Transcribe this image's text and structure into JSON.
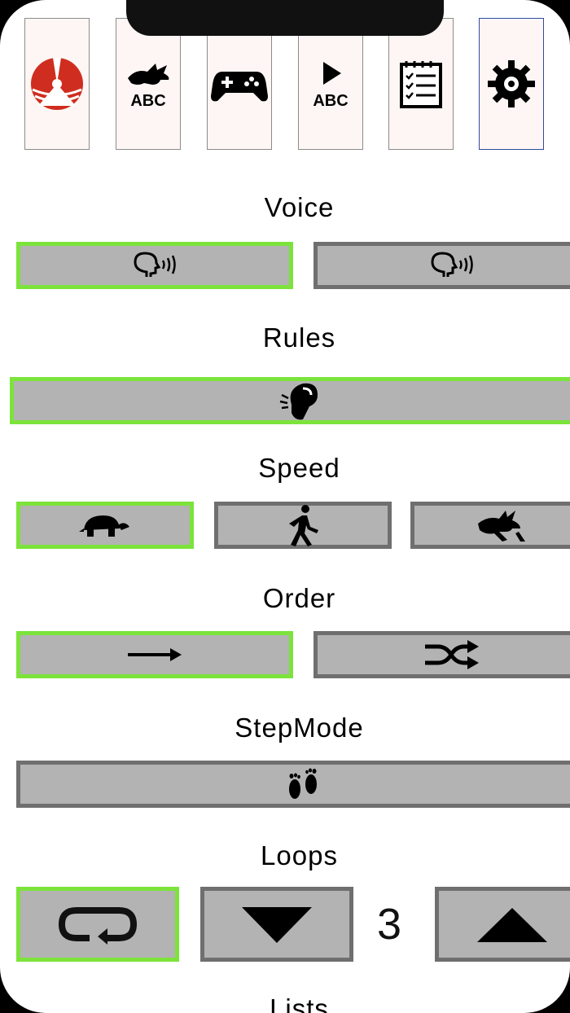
{
  "headings": {
    "voice": "Voice",
    "rules": "Rules",
    "speed": "Speed",
    "order": "Order",
    "stepmode": "StepMode",
    "loops": "Loops",
    "lists": "Lists"
  },
  "loops": {
    "count": "3"
  },
  "tabs": [
    {
      "icon": "target-logo-icon",
      "active": false
    },
    {
      "icon": "rabbit-abc-icon",
      "active": false
    },
    {
      "icon": "gamepad-icon",
      "active": false
    },
    {
      "icon": "play-abc-icon",
      "active": false
    },
    {
      "icon": "checklist-icon",
      "active": false
    },
    {
      "icon": "gear-icon",
      "active": true
    }
  ],
  "tab_labels": {
    "abc": "ABC"
  },
  "colors": {
    "selected_border": "#7ce33b",
    "button_fill": "#b3b3b3",
    "button_border": "#6f6f6f",
    "active_tab_border": "#2f4aa0"
  }
}
